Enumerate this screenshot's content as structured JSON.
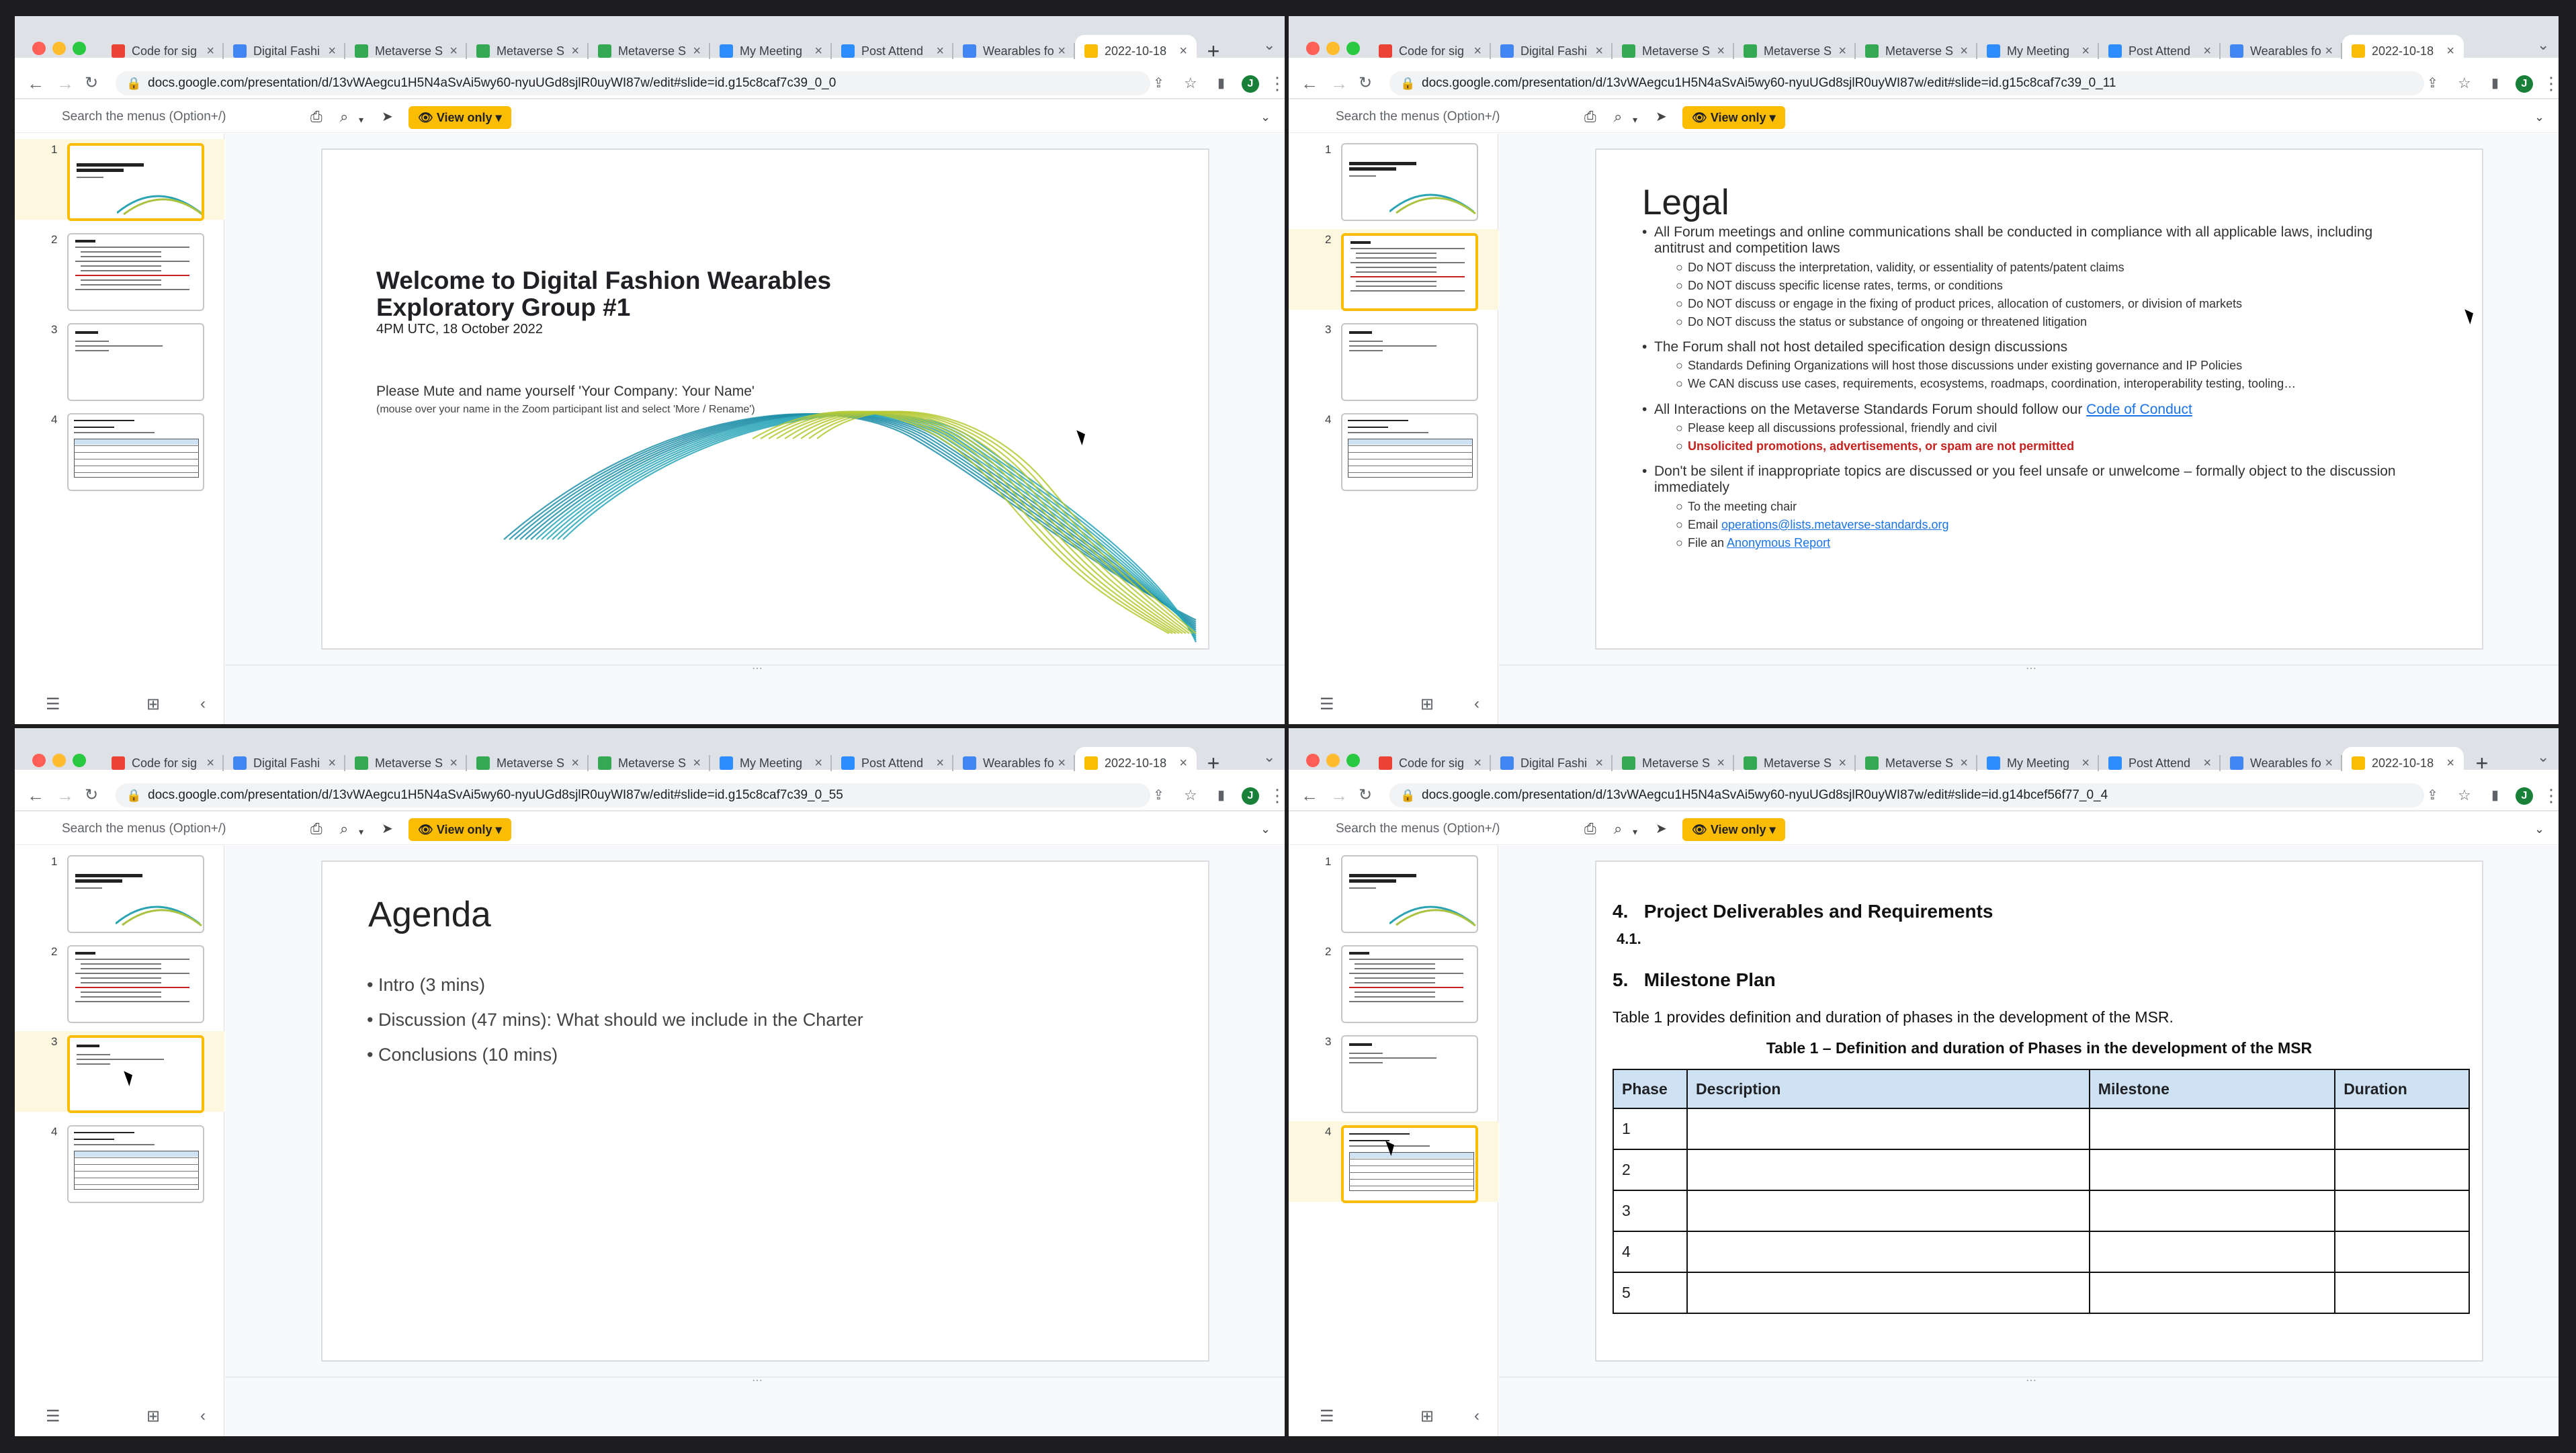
{
  "tabs": [
    {
      "label": "Code for sig",
      "icon": "gmail-icon",
      "color": "#ea4335"
    },
    {
      "label": "Digital Fashi",
      "icon": "docs-icon",
      "color": "#4285f4"
    },
    {
      "label": "Metaverse S",
      "icon": "metaverse-icon",
      "color": "#34a853"
    },
    {
      "label": "Metaverse S",
      "icon": "metaverse-icon",
      "color": "#34a853"
    },
    {
      "label": "Metaverse S",
      "icon": "metaverse-icon",
      "color": "#34a853"
    },
    {
      "label": "My Meeting",
      "icon": "zoom-icon",
      "color": "#2d8cff"
    },
    {
      "label": "Post Attend",
      "icon": "zoom-icon",
      "color": "#2d8cff"
    },
    {
      "label": "Wearables fo",
      "icon": "docs-icon",
      "color": "#4285f4"
    },
    {
      "label": "2022-10-18",
      "icon": "slides-icon",
      "color": "#fbbc04"
    }
  ],
  "urls": {
    "tl": "docs.google.com/presentation/d/13vWAegcu1H5N4aSvAi5wy60-nyuUGd8sjlR0uyWI87w/edit#slide=id.g15c8caf7c39_0_0",
    "tr": "docs.google.com/presentation/d/13vWAegcu1H5N4aSvAi5wy60-nyuUGd8sjlR0uyWI87w/edit#slide=id.g15c8caf7c39_0_11",
    "bl": "docs.google.com/presentation/d/13vWAegcu1H5N4aSvAi5wy60-nyuUGd8sjlR0uyWI87w/edit#slide=id.g15c8caf7c39_0_55",
    "br": "docs.google.com/presentation/d/13vWAegcu1H5N4aSvAi5wy60-nyuUGd8sjlR0uyWI87w/edit#slide=id.g14bcef56f77_0_4"
  },
  "toolbar": {
    "search_placeholder": "Search the menus (Option+/)",
    "view_only": "View only",
    "avatar": "J"
  },
  "slide_numbers": [
    "1",
    "2",
    "3",
    "4"
  ],
  "slide1": {
    "title": "Welcome to Digital Fashion Wearables Exploratory Group #1",
    "subtitle": "4PM UTC, 18 October 2022",
    "mute": "Please Mute and name yourself 'Your Company: Your Name'",
    "mute_hint": "(mouse over your name in the Zoom participant list and select 'More / Rename')"
  },
  "slide2": {
    "title": "Legal",
    "b1": "All Forum meetings and online communications shall be conducted in compliance with all applicable laws, including",
    "b1_cont": "antitrust and competition laws",
    "b1_subs": [
      "Do NOT discuss the interpretation, validity, or essentiality of patents/patent claims",
      "Do NOT discuss specific license rates, terms, or conditions",
      "Do NOT discuss or engage in the fixing of product prices, allocation of customers, or division of markets",
      "Do NOT discuss the status or substance of ongoing or threatened litigation"
    ],
    "b2": "The Forum shall not host detailed specification design discussions",
    "b2_subs": [
      "Standards Defining Organizations will host those discussions under existing governance and IP Policies",
      "We CAN discuss use cases, requirements, ecosystems, roadmaps, coordination, interoperability testing, tooling…"
    ],
    "b3": "All Interactions on the Metaverse Standards Forum should follow our",
    "b3_link": "Code of Conduct",
    "b3_sub1": "Please keep all discussions professional, friendly and civil",
    "b3_sub2": "Unsolicited promotions, advertisements, or spam are not permitted",
    "b4": "Don't be silent if inappropriate topics are discussed or you feel unsafe or unwelcome – formally object to the discussion",
    "b4_cont": "immediately",
    "b4_sub1": "To the meeting chair",
    "b4_sub2_prefix": "Email",
    "b4_sub2_link": "operations@lists.metaverse-standards.org",
    "b4_sub3_prefix": "File an",
    "b4_sub3_link": "Anonymous Report"
  },
  "slide3": {
    "title": "Agenda",
    "items": [
      "Intro (3 mins)",
      "Discussion (47 mins): What should we include in the Charter",
      "Conclusions (10 mins)"
    ]
  },
  "slide4": {
    "h4_num": "4.",
    "h4": "Project Deliverables and Requirements",
    "h41": "4.1.",
    "h5_num": "5.",
    "h5": "Milestone Plan",
    "para": "Table 1 provides definition and duration of phases in the development of the MSR.",
    "caption": "Table 1 – Definition and duration of Phases in the development of the MSR",
    "headers": [
      "Phase",
      "Description",
      "Milestone",
      "Duration"
    ],
    "rows": [
      "1",
      "2",
      "3",
      "4",
      "5"
    ]
  }
}
